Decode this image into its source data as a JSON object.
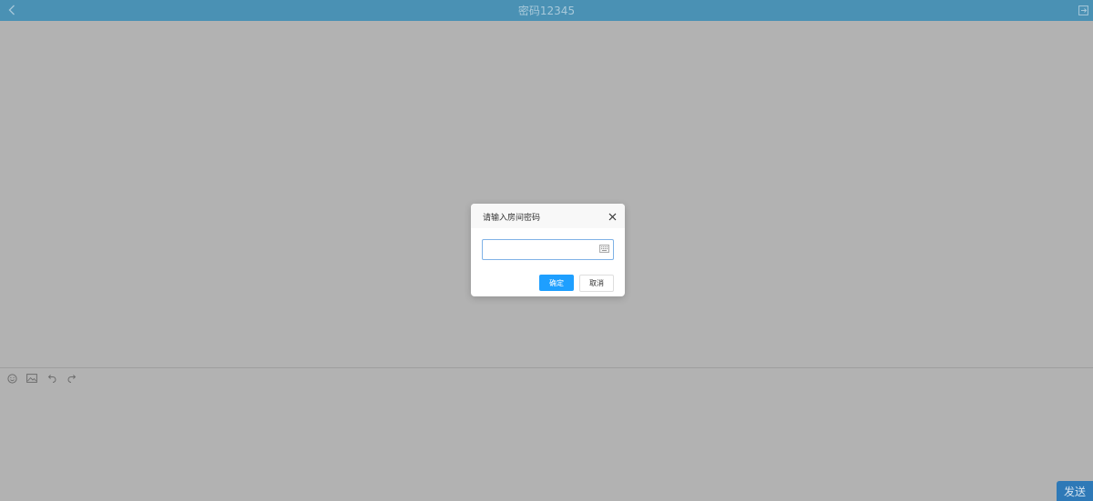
{
  "header": {
    "title": "密码12345",
    "back_icon": "chevron-left-icon",
    "exit_icon": "exit-icon"
  },
  "composer": {
    "tools": [
      {
        "icon": "emoji-icon"
      },
      {
        "icon": "image-icon"
      },
      {
        "icon": "undo-icon"
      },
      {
        "icon": "redo-icon"
      }
    ],
    "send_label": "发送"
  },
  "dialog": {
    "title": "请输入房间密码",
    "password_value": "",
    "ok_label": "确定",
    "cancel_label": "取消",
    "close_icon": "close-icon",
    "keyboard_icon": "keyboard-icon"
  },
  "colors": {
    "header_bg": "#4a91b4",
    "overlay_bg": "#b2b2b2",
    "primary": "#1e9fff",
    "send_bg": "#2e79b7"
  }
}
